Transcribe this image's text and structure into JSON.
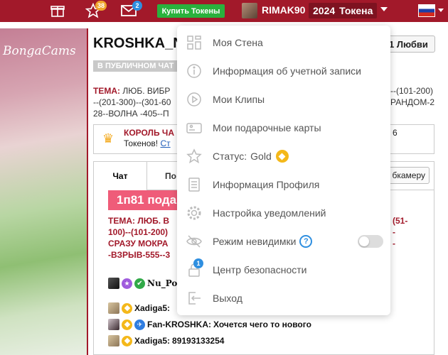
{
  "topbar": {
    "bag_badge": "",
    "stars_badge": "38",
    "mail_badge": "2",
    "buy_label": "Купить Токены",
    "username": "RIMAK90",
    "token_count": "2024",
    "token_label": "Токена"
  },
  "page": {
    "logo": "BongaCams",
    "title": "KROSHKA_N",
    "love_label": "1 Любви",
    "public_chat": "В ПУБЛИЧНОМ ЧАТ",
    "topic_label": "ТЕМА:",
    "topic_text": "ЛЮБ. ВИБР",
    "topic_line2": "--(201-300)--(301-60",
    "topic_line3": "28--ВОЛНА -405--П",
    "topic_right1": "--(101-200)",
    "topic_right2": "РАНДОМ-2",
    "king_title": "КОРОЛЬ ЧА",
    "king_sub": "Токенов!",
    "king_link": "Ст",
    "king_num": "6"
  },
  "chat": {
    "tab_chat": "Чат",
    "tab_other": "По",
    "cam_label": "бкамеру",
    "banner": "1п81 пода",
    "topic_l1": "ТЕМА: ЛЮБ. В",
    "topic_l2": "100)--(101-200)",
    "topic_l3": "СРАЗУ МОКРА",
    "topic_l4": "-ВЗРЫВ-555--3",
    "topic_r1": "(51-",
    "topic_r2": "-",
    "topic_r3": "-",
    "messages": [
      {
        "user": "Nu_Po",
        "text": ""
      },
      {
        "user": "Xadiga5:",
        "text": ""
      },
      {
        "user": "Fan-KROSHKA:",
        "text": "Хочется чего то нового"
      },
      {
        "user": "Xadiga5:",
        "text": "89193133254"
      }
    ]
  },
  "menu": {
    "items": [
      {
        "label": "Моя Стена",
        "icon": "wall-icon"
      },
      {
        "label": "Информация об учетной записи",
        "icon": "info-icon"
      },
      {
        "label": "Мои Клипы",
        "icon": "play-icon"
      },
      {
        "label": "Мои подарочные карты",
        "icon": "gift-card-icon"
      },
      {
        "label": "Статус:",
        "value": "Gold",
        "icon": "star-icon"
      },
      {
        "label": "Информация Профиля",
        "icon": "document-icon"
      },
      {
        "label": "Настройка уведомлений",
        "icon": "gear-icon"
      },
      {
        "label": "Режим невидимки",
        "icon": "eye-off-icon",
        "help": "?"
      },
      {
        "label": "Центр безопасности",
        "icon": "lock-icon",
        "badge": "1"
      },
      {
        "label": "Выход",
        "icon": "logout-icon"
      }
    ]
  },
  "colors": {
    "topbar": "#a2192a",
    "buy_button": "#2ab13d",
    "gold": "#f4b81a",
    "accent_blue": "#2f8fe0"
  }
}
